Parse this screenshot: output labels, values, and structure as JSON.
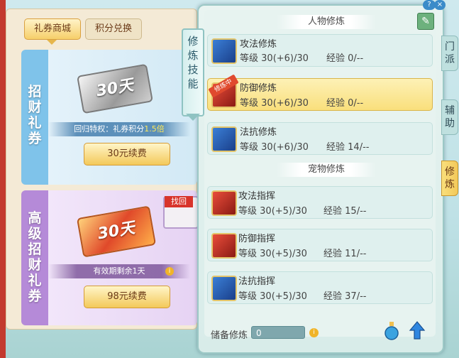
{
  "shop": {
    "tabs": [
      "礼券商城",
      "积分兑换"
    ],
    "card1": {
      "title_chars": [
        "招",
        "财",
        "礼",
        "券"
      ],
      "ticket_text": "30天",
      "info_prefix": "回归特权：礼券积分",
      "info_highlight": "1.5倍",
      "button": "30元续费"
    },
    "card2": {
      "title_chars": [
        "高",
        "级",
        "招",
        "财",
        "礼",
        "券"
      ],
      "ticket_text": "30天",
      "badge": "找回",
      "info": "有效期剩余1天",
      "info_icon": "i",
      "button": "98元续费"
    }
  },
  "panel": {
    "side_banner": [
      "修",
      "炼",
      "技",
      "能"
    ],
    "sections": {
      "character": "人物修炼",
      "pet": "宠物修炼"
    },
    "training_badge": "修炼中",
    "character_skills": [
      {
        "name": "攻法修炼",
        "level_label": "等级",
        "level": "30(+6)/30",
        "exp_label": "经验",
        "exp": "0/--",
        "icon": "attack-magic-icon",
        "active": false
      },
      {
        "name": "防御修炼",
        "level_label": "等级",
        "level": "30(+6)/30",
        "exp_label": "经验",
        "exp": "0/--",
        "icon": "defense-icon",
        "active": true
      },
      {
        "name": "法抗修炼",
        "level_label": "等级",
        "level": "30(+6)/30",
        "exp_label": "经验",
        "exp": "14/--",
        "icon": "magic-resist-icon",
        "active": false
      }
    ],
    "pet_skills": [
      {
        "name": "攻法指挥",
        "level_label": "等级",
        "level": "30(+5)/30",
        "exp_label": "经验",
        "exp": "15/--",
        "icon": "pet-attack-icon"
      },
      {
        "name": "防御指挥",
        "level_label": "等级",
        "level": "30(+5)/30",
        "exp_label": "经验",
        "exp": "11/--",
        "icon": "pet-defense-icon"
      },
      {
        "name": "法抗指挥",
        "level_label": "等级",
        "level": "30(+5)/30",
        "exp_label": "经验",
        "exp": "37/--",
        "icon": "pet-resist-icon"
      }
    ],
    "reserve_label": "储备修炼",
    "reserve_value": "0",
    "reserve_info_icon": "i"
  },
  "side_tabs": {
    "sect": [
      "门",
      "派"
    ],
    "assist": [
      "辅",
      "助"
    ],
    "cultivate": [
      "修",
      "炼"
    ]
  },
  "window": {
    "help": "?",
    "close": "×"
  }
}
